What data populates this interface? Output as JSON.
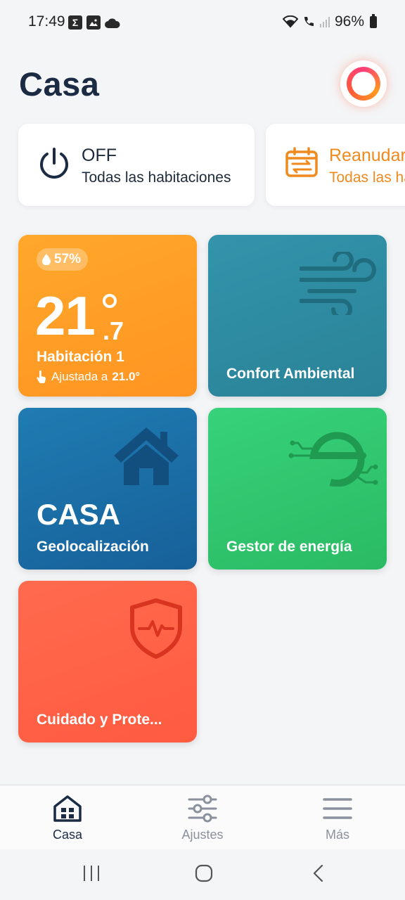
{
  "status_bar": {
    "time": "17:49",
    "battery": "96%",
    "icons": [
      "sigma-app-icon",
      "gallery-icon",
      "cloud-icon",
      "wifi-icon",
      "wifi-calling-icon",
      "signal-icon",
      "battery-icon"
    ]
  },
  "header": {
    "title": "Casa"
  },
  "quick_actions": [
    {
      "title": "OFF",
      "subtitle": "Todas las habitaciones",
      "icon": "power-icon"
    },
    {
      "title": "Reanudar",
      "subtitle": "Todas las habitaciones",
      "icon": "calendar-resume-icon",
      "color": "#ef8a1e"
    }
  ],
  "tiles": {
    "room": {
      "humidity": "57%",
      "temp_int": "21",
      "temp_dec": ".7",
      "name": "Habitación 1",
      "set_prefix": "Ajustada a",
      "set_value": "21.0°",
      "color": "#ffa82b"
    },
    "comfort": {
      "label": "Confort Ambiental",
      "color": "#3294ab"
    },
    "geo": {
      "big": "CASA",
      "label": "Geolocalización",
      "color": "#1f7cb2"
    },
    "energy": {
      "label": "Gestor de energía",
      "color": "#36d27a"
    },
    "care": {
      "label": "Cuidado y Prote...",
      "color": "#ff6a4e"
    }
  },
  "bottom_nav": {
    "items": [
      {
        "label": "Casa",
        "icon": "home-grid-icon",
        "active": true
      },
      {
        "label": "Ajustes",
        "icon": "sliders-icon",
        "active": false
      },
      {
        "label": "Más",
        "icon": "menu-icon",
        "active": false
      }
    ]
  },
  "colors": {
    "accent_dark": "#1c2b44",
    "background": "#f4f5f7"
  }
}
